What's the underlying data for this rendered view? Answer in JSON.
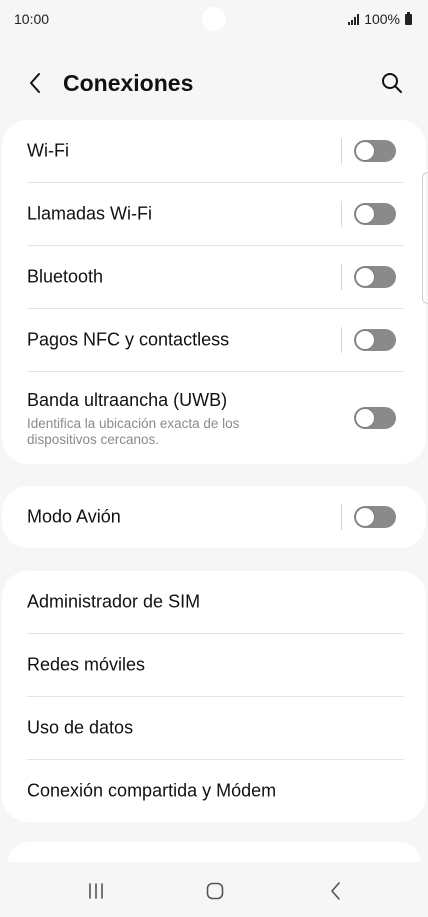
{
  "status_bar": {
    "time": "10:00",
    "battery": "100%",
    "icons": [
      "signal-icon",
      "battery-icon"
    ]
  },
  "header": {
    "title": "Conexiones",
    "back_icon": "chevron-left-icon",
    "search_icon": "search-icon"
  },
  "groups": [
    {
      "items": [
        {
          "label": "Wi-Fi",
          "toggle": "off"
        },
        {
          "label": "Llamadas Wi-Fi",
          "toggle": "off"
        },
        {
          "label": "Bluetooth",
          "toggle": "off"
        },
        {
          "label": "Pagos NFC y contactless",
          "toggle": "off"
        },
        {
          "label": "Banda ultraancha (UWB)",
          "subtitle": "Identifica la ubicación exacta de los dispositivos cercanos.",
          "toggle": "off"
        }
      ]
    },
    {
      "items": [
        {
          "label": "Modo Avión",
          "toggle": "off"
        }
      ]
    },
    {
      "items": [
        {
          "label": "Administrador de SIM"
        },
        {
          "label": "Redes móviles"
        },
        {
          "label": "Uso de datos"
        },
        {
          "label": "Conexión compartida y Módem"
        }
      ]
    }
  ],
  "nav_bar": {
    "icons": [
      "recent-apps-icon",
      "home-icon",
      "back-icon"
    ]
  },
  "colors": {
    "background": "#f6f6f6",
    "card": "#ffffff",
    "toggle_off": "#8a8a8a",
    "subtitle": "#8a8a8a"
  }
}
